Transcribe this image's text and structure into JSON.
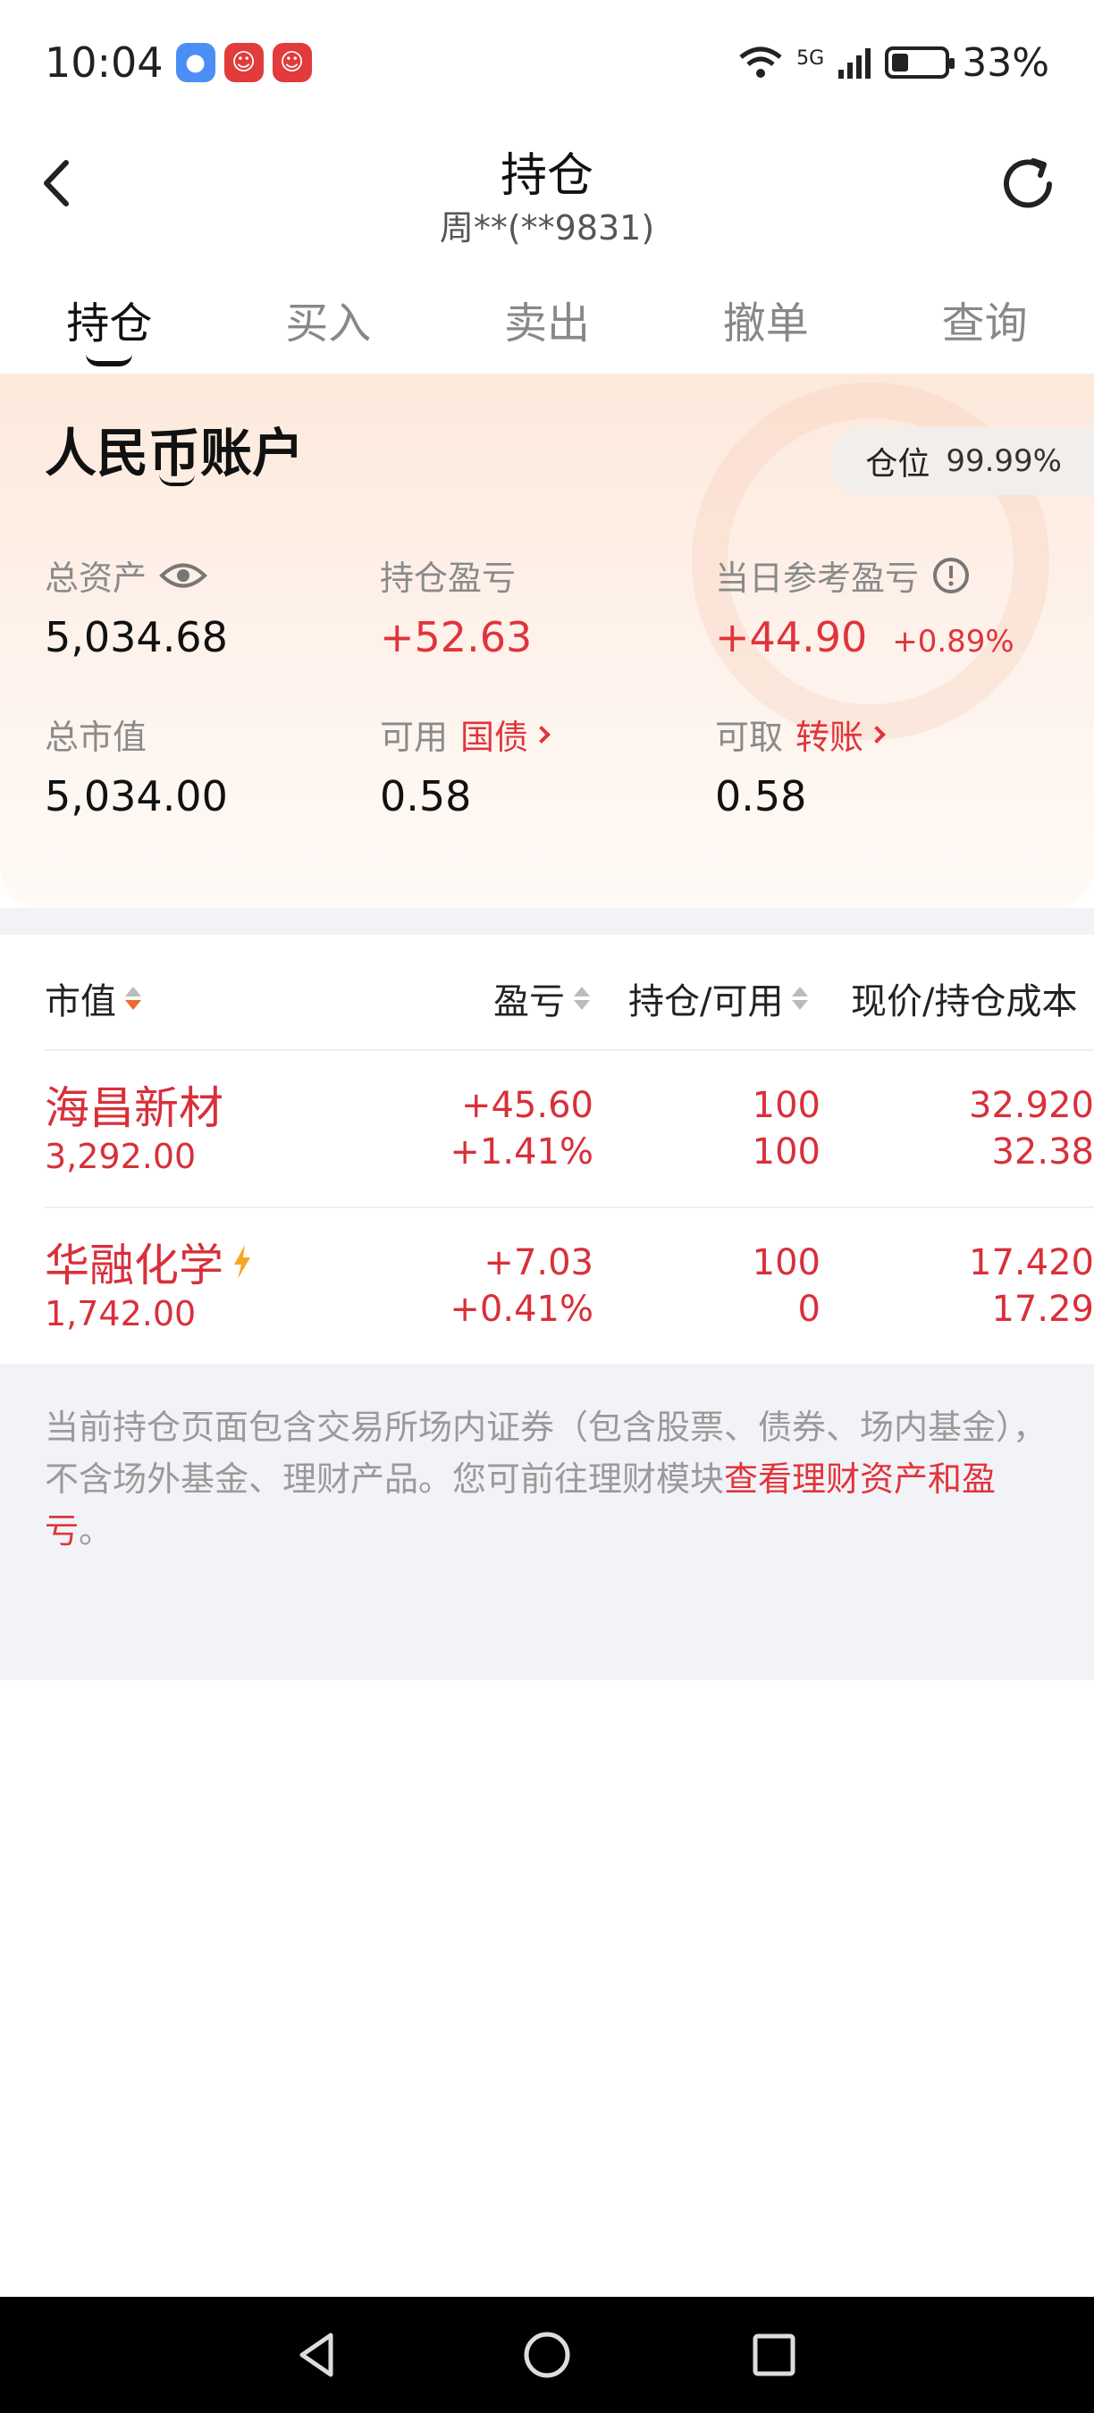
{
  "status_bar": {
    "time": "10:04",
    "network": "5G",
    "battery_percent": "33%",
    "battery_level": 0.33,
    "notification_icons": [
      "messages-icon",
      "app-icon",
      "app-icon"
    ]
  },
  "header": {
    "title": "持仓",
    "subtitle": "周**(**9831)"
  },
  "tabs": [
    {
      "label": "持仓",
      "active": true
    },
    {
      "label": "买入",
      "active": false
    },
    {
      "label": "卖出",
      "active": false
    },
    {
      "label": "撤单",
      "active": false
    },
    {
      "label": "查询",
      "active": false
    }
  ],
  "account": {
    "title": "人民币账户",
    "position_label": "仓位",
    "position_value": "99.99%",
    "total_assets_label": "总资产",
    "total_assets_value": "5,034.68",
    "holding_pnl_label": "持仓盈亏",
    "holding_pnl_value": "+52.63",
    "daily_pnl_label": "当日参考盈亏",
    "daily_pnl_value": "+44.90",
    "daily_pnl_pct": "+0.89%",
    "market_value_label": "总市值",
    "market_value_value": "5,034.00",
    "available_label": "可用",
    "available_link": "国债",
    "available_value": "0.58",
    "withdrawable_label": "可取",
    "withdrawable_link": "转账",
    "withdrawable_value": "0.58"
  },
  "table": {
    "headers": {
      "market_value": "市值",
      "pnl": "盈亏",
      "holding_available": "持仓/可用",
      "price_cost": "现价/持仓成本"
    },
    "rows": [
      {
        "name": "海昌新材",
        "market_value": "3,292.00",
        "pnl": "+45.60",
        "pnl_pct": "+1.41%",
        "holding": "100",
        "available": "100",
        "price": "32.920",
        "cost": "32.38",
        "badge": false
      },
      {
        "name": "华融化学",
        "market_value": "1,742.00",
        "pnl": "+7.03",
        "pnl_pct": "+0.41%",
        "holding": "100",
        "available": "0",
        "price": "17.420",
        "cost": "17.29",
        "badge": true
      }
    ]
  },
  "note": {
    "text": "当前持仓页面包含交易所场内证券（包含股票、债券、场内基金），不含场外基金、理财产品。您可前往理财模块",
    "link": "查看理财资产和盈亏",
    "suffix": "。"
  },
  "colors": {
    "accent_red": "#e0343c",
    "sort_active": "#f06a2c",
    "card_bg": "#fde9dc"
  }
}
